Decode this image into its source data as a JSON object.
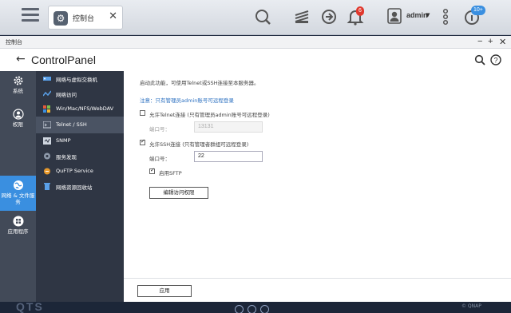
{
  "taskbar": {
    "app_tab_label": "控制台",
    "notification_count": "6",
    "user_name": "admin",
    "update_badge": "10+"
  },
  "window": {
    "title": "控制台",
    "app_title": "ControlPanel"
  },
  "left_nav": [
    {
      "label": "系统",
      "icon": "gear-icon"
    },
    {
      "label": "权限",
      "icon": "user-icon"
    },
    {
      "label": "网络 & 文件服务",
      "icon": "globe-icon"
    },
    {
      "label": "应用程序",
      "icon": "apps-grid-icon"
    }
  ],
  "left_nav_active": 2,
  "sub_nav": [
    {
      "label": "网络与虚拟交换机",
      "icon": "network-switch-icon"
    },
    {
      "label": "网络访问",
      "icon": "network-access-icon"
    },
    {
      "label": "Win/Mac/NFS/WebDAV",
      "icon": "os-sharing-icon"
    },
    {
      "label": "Telnet / SSH",
      "icon": "terminal-icon"
    },
    {
      "label": "SNMP",
      "icon": "snmp-icon"
    },
    {
      "label": "服务发现",
      "icon": "service-discovery-icon"
    },
    {
      "label": "QuFTP Service",
      "icon": "ftp-icon"
    },
    {
      "label": "网络资源回收站",
      "icon": "recycle-bin-icon"
    }
  ],
  "sub_nav_active": 3,
  "content": {
    "intro": "启动此功能，可使用Telnet或SSH连接至本服务器。",
    "note": "注意：只有管理员admin账号可远程登录",
    "telnet": {
      "label": "允许Telnet连接 (只有管理员admin账号可远程登录)",
      "checked": false,
      "port_label": "端口号：",
      "port_value": "13131"
    },
    "ssh": {
      "label": "允许SSH连接 (只有管理者群组可远程登录)",
      "checked": true,
      "port_label": "端口号：",
      "port_value": "22",
      "sftp_label": "启用SFTP",
      "sftp_checked": true,
      "edit_button": "编辑访问权限"
    },
    "apply_button": "应用"
  },
  "desktop": {
    "logo": "QTS",
    "copyright": "© QNAP"
  },
  "colors": {
    "accent": "#3a8fe0",
    "sidebar": "#424a58",
    "subnav": "#2f3644"
  }
}
